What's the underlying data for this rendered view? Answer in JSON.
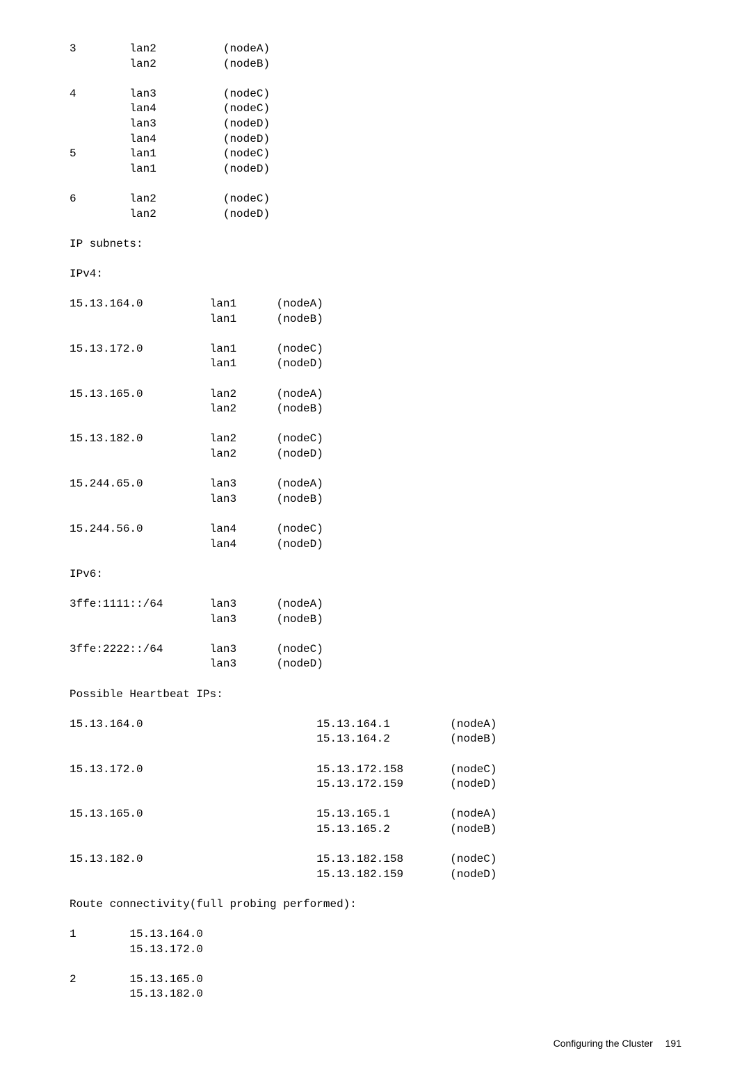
{
  "sections": {
    "ip_subnets_label": "IP subnets:",
    "ipv4_label": "IPv4:",
    "ipv6_label": "IPv6:",
    "heartbeat_label": "Possible Heartbeat IPs:",
    "route_label": "Route connectivity(full probing performed):"
  },
  "top_rows": [
    {
      "idx": "3",
      "col2": "lan2",
      "col3": "(nodeA)"
    },
    {
      "idx": "",
      "col2": "lan2",
      "col3": "(nodeB)"
    },
    {
      "idx": "",
      "col2": "",
      "col3": ""
    },
    {
      "idx": "4",
      "col2": "lan3",
      "col3": "(nodeC)"
    },
    {
      "idx": "",
      "col2": "lan4",
      "col3": "(nodeC)"
    },
    {
      "idx": "",
      "col2": "lan3",
      "col3": "(nodeD)"
    },
    {
      "idx": "",
      "col2": "lan4",
      "col3": "(nodeD)"
    },
    {
      "idx": "5",
      "col2": "lan1",
      "col3": "(nodeC)"
    },
    {
      "idx": "",
      "col2": "lan1",
      "col3": "(nodeD)"
    },
    {
      "idx": "",
      "col2": "",
      "col3": ""
    },
    {
      "idx": "6",
      "col2": "lan2",
      "col3": "(nodeC)"
    },
    {
      "idx": "",
      "col2": "lan2",
      "col3": "(nodeD)"
    }
  ],
  "ipv4_rows": [
    {
      "subnet": "15.13.164.0",
      "iface": "lan1",
      "node": "(nodeA)"
    },
    {
      "subnet": "",
      "iface": "lan1",
      "node": "(nodeB)"
    },
    {
      "subnet": "",
      "iface": "",
      "node": ""
    },
    {
      "subnet": "15.13.172.0",
      "iface": "lan1",
      "node": "(nodeC)"
    },
    {
      "subnet": "",
      "iface": "lan1",
      "node": "(nodeD)"
    },
    {
      "subnet": "",
      "iface": "",
      "node": ""
    },
    {
      "subnet": "15.13.165.0",
      "iface": "lan2",
      "node": "(nodeA)"
    },
    {
      "subnet": "",
      "iface": "lan2",
      "node": "(nodeB)"
    },
    {
      "subnet": "",
      "iface": "",
      "node": ""
    },
    {
      "subnet": "15.13.182.0",
      "iface": "lan2",
      "node": "(nodeC)"
    },
    {
      "subnet": "",
      "iface": "lan2",
      "node": "(nodeD)"
    },
    {
      "subnet": "",
      "iface": "",
      "node": ""
    },
    {
      "subnet": "15.244.65.0",
      "iface": "lan3",
      "node": "(nodeA)"
    },
    {
      "subnet": "",
      "iface": "lan3",
      "node": "(nodeB)"
    },
    {
      "subnet": "",
      "iface": "",
      "node": ""
    },
    {
      "subnet": "15.244.56.0",
      "iface": "lan4",
      "node": "(nodeC)"
    },
    {
      "subnet": "",
      "iface": "lan4",
      "node": "(nodeD)"
    }
  ],
  "ipv6_rows": [
    {
      "subnet": "3ffe:1111::/64",
      "iface": "lan3",
      "node": "(nodeA)"
    },
    {
      "subnet": "",
      "iface": "lan3",
      "node": "(nodeB)"
    },
    {
      "subnet": "",
      "iface": "",
      "node": ""
    },
    {
      "subnet": "3ffe:2222::/64",
      "iface": "lan3",
      "node": "(nodeC)"
    },
    {
      "subnet": "",
      "iface": "lan3",
      "node": "(nodeD)"
    }
  ],
  "heartbeat_rows": [
    {
      "subnet": "15.13.164.0",
      "ip": "15.13.164.1",
      "node": "(nodeA)"
    },
    {
      "subnet": "",
      "ip": "15.13.164.2",
      "node": "(nodeB)"
    },
    {
      "subnet": "",
      "ip": "",
      "node": ""
    },
    {
      "subnet": "15.13.172.0",
      "ip": "15.13.172.158",
      "node": "(nodeC)"
    },
    {
      "subnet": "",
      "ip": "15.13.172.159",
      "node": "(nodeD)"
    },
    {
      "subnet": "",
      "ip": "",
      "node": ""
    },
    {
      "subnet": "15.13.165.0",
      "ip": "15.13.165.1",
      "node": "(nodeA)"
    },
    {
      "subnet": "",
      "ip": "15.13.165.2",
      "node": "(nodeB)"
    },
    {
      "subnet": "",
      "ip": "",
      "node": ""
    },
    {
      "subnet": "15.13.182.0",
      "ip": "15.13.182.158",
      "node": "(nodeC)"
    },
    {
      "subnet": "",
      "ip": "15.13.182.159",
      "node": "(nodeD)"
    }
  ],
  "route_rows": [
    {
      "idx": "1",
      "ip": "15.13.164.0"
    },
    {
      "idx": "",
      "ip": "15.13.172.0"
    },
    {
      "idx": "",
      "ip": ""
    },
    {
      "idx": "2",
      "ip": "15.13.165.0"
    },
    {
      "idx": "",
      "ip": "15.13.182.0"
    }
  ],
  "footer": {
    "text": "Configuring the Cluster",
    "page": "191"
  }
}
